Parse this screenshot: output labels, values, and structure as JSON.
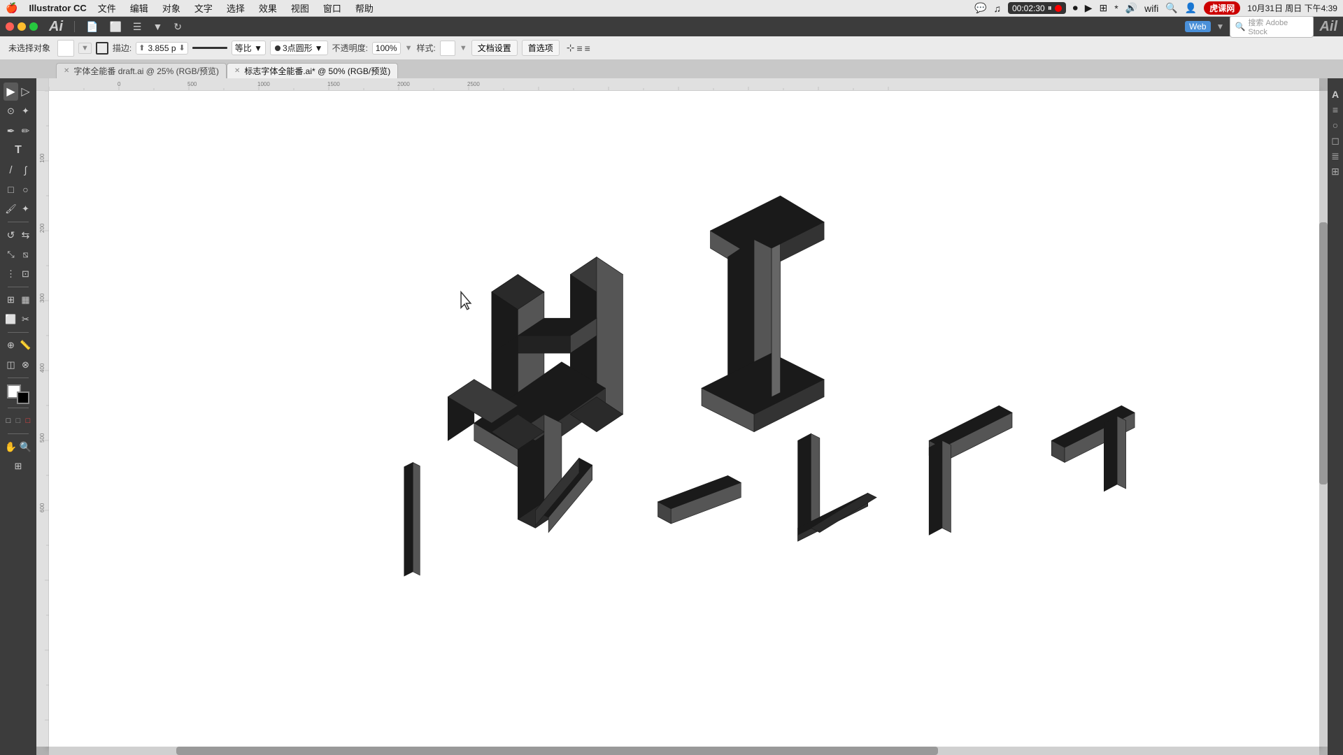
{
  "menubar": {
    "apple": "⌘",
    "app_name": "Illustrator CC",
    "menus": [
      "文件",
      "编辑",
      "对象",
      "文字",
      "选择",
      "效果",
      "视图",
      "窗口",
      "帮助"
    ],
    "timer": "00:02:30",
    "datetime": "10月31日 周日 下午4:39"
  },
  "app_toolbar": {
    "window_controls": [
      "close",
      "minimize",
      "maximize"
    ],
    "ai_logo": "Ai",
    "icons": [
      "📄",
      "⬜",
      "⬜",
      "⬛"
    ]
  },
  "toolbar": {
    "no_selection": "未选择对象",
    "stroke_label": "描边:",
    "stroke_value": "3.855 p",
    "stroke_dropdown": "等比",
    "pts_label": "3点圆形",
    "opacity_label": "不透明度:",
    "opacity_value": "100%",
    "style_label": "样式:",
    "doc_settings": "文档设置",
    "prefs": "首选项"
  },
  "tabs": [
    {
      "id": "tab1",
      "label": "字体全能番 draft.ai @ 25% (RGB/预览)",
      "active": false,
      "closeable": true
    },
    {
      "id": "tab2",
      "label": "标志字体全能番.ai* @ 50% (RGB/预览)",
      "active": true,
      "closeable": true
    }
  ],
  "tools": {
    "selection": "▶",
    "direct_select": "▷",
    "lasso": "⌖",
    "pen": "✒",
    "pencil": "✏",
    "type": "T",
    "line": "/",
    "rect": "□",
    "ellipse": "○",
    "brush": "🖌",
    "rotate": "↺",
    "scale": "⤡",
    "warp": "⋮",
    "eyedropper": "⊕",
    "gradient": "◫",
    "blend": "⊗",
    "chart": "▦",
    "artboard": "□",
    "hand": "✋",
    "zoom": "🔍",
    "slice": "✂"
  },
  "right_panel": {
    "icons": [
      "A",
      "≡",
      "○",
      "◻",
      "≣",
      "⊞"
    ]
  },
  "canvas": {
    "background_color": "#b8b8b8",
    "artboard_color": "#ffffff"
  },
  "watermark": {
    "text": "Ail",
    "subtext": "虎课网"
  },
  "page_indicator": "未选择对象"
}
